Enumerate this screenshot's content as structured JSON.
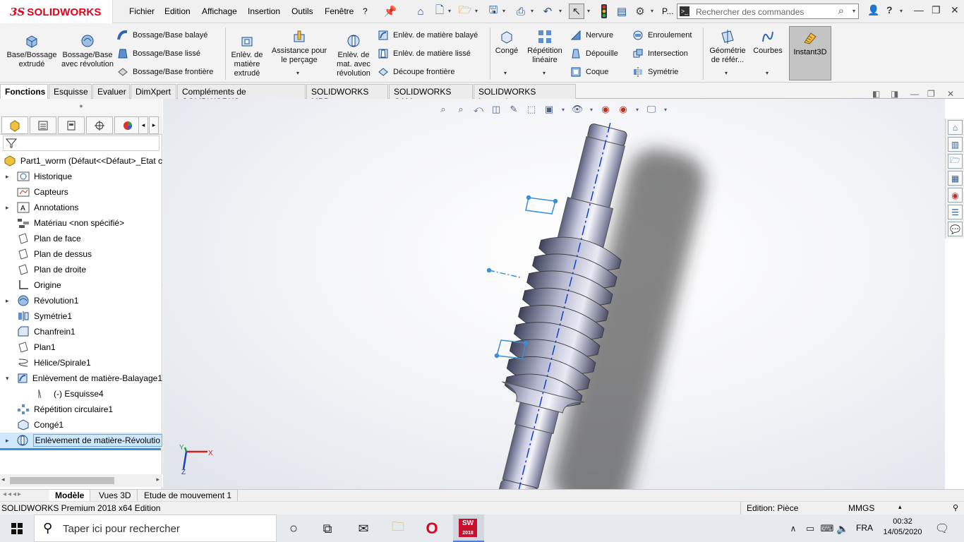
{
  "app": {
    "brand_ds": "3S",
    "brand_name": "SOLIDWORKS"
  },
  "menu": [
    "Fichier",
    "Edition",
    "Affichage",
    "Insertion",
    "Outils",
    "Fenêtre",
    "?"
  ],
  "quick_access": {
    "p_label": "P..."
  },
  "search": {
    "placeholder": "Rechercher des commandes"
  },
  "ribbon": {
    "extrude_boss": "Base/Bossage extrudé",
    "revolve_boss": "Bossage/Base avec révolution",
    "swept_boss": "Bossage/Base balayé",
    "lofted_boss": "Bossage/Base lissé",
    "boundary_boss": "Bossage/Base frontière",
    "extruded_cut": "Enlèv. de matière extrudé",
    "hole_wizard": "Assistance pour le perçage",
    "revolved_cut": "Enlèv. de mat. avec révolution",
    "swept_cut": "Enlèv. de matière balayé",
    "lofted_cut": "Enlèv. de matière lissé",
    "boundary_cut": "Découpe frontière",
    "fillet": "Congé",
    "linear_pattern": "Répétition linéaire",
    "rib": "Nervure",
    "draft": "Dépouille",
    "shell": "Coque",
    "wrap": "Enroulement",
    "intersect": "Intersection",
    "mirror": "Symétrie",
    "ref_geometry": "Géométrie de référ...",
    "curves": "Courbes",
    "instant3d": "Instant3D"
  },
  "tabs": [
    "Fonctions",
    "Esquisse",
    "Evaluer",
    "DimXpert",
    "Compléments de SOLIDWORKS",
    "SOLIDWORKS MBD",
    "SOLIDWORKS CAM",
    "SOLIDWORKS Inspection"
  ],
  "tree": {
    "root": "Part1_worm  (Défaut<<Défaut>_Etat c",
    "items": [
      {
        "label": "Historique",
        "icon": "history-icon"
      },
      {
        "label": "Capteurs",
        "icon": "sensor-icon"
      },
      {
        "label": "Annotations",
        "icon": "annotation-icon"
      },
      {
        "label": "Matériau <non spécifié>",
        "icon": "material-icon"
      },
      {
        "label": "Plan de face",
        "icon": "plane-icon"
      },
      {
        "label": "Plan de dessus",
        "icon": "plane-icon"
      },
      {
        "label": "Plan de droite",
        "icon": "plane-icon"
      },
      {
        "label": "Origine",
        "icon": "origin-icon"
      },
      {
        "label": "Révolution1",
        "icon": "revolve-icon"
      },
      {
        "label": "Symétrie1",
        "icon": "mirror-icon"
      },
      {
        "label": "Chanfrein1",
        "icon": "chamfer-icon"
      },
      {
        "label": "Plan1",
        "icon": "plane-icon"
      },
      {
        "label": "Hélice/Spirale1",
        "icon": "helix-icon"
      },
      {
        "label": "Enlèvement de matière-Balayage1",
        "icon": "swept-cut-icon"
      },
      {
        "label": "(-) Esquisse4",
        "icon": "sketch-icon"
      },
      {
        "label": "Répétition circulaire1",
        "icon": "circular-pattern-icon"
      },
      {
        "label": "Congé1",
        "icon": "fillet-icon"
      },
      {
        "label": "Enlèvement de matière-Révolutio",
        "icon": "revolved-cut-icon"
      }
    ]
  },
  "bottom_tabs": [
    "Modèle",
    "Vues 3D",
    "Etude de mouvement 1"
  ],
  "status": {
    "edition": "SOLIDWORKS Premium 2018 x64 Edition",
    "mode": "Edition: Pièce",
    "units": "MMGS"
  },
  "triad": {
    "x": "X",
    "y": "Y",
    "z": "Z"
  },
  "taskbar": {
    "search": "Taper ici pour rechercher",
    "sw_badge": "SW",
    "sw_year": "2018",
    "lang": "FRA",
    "time": "00:32",
    "date": "14/05/2020"
  },
  "colors": {
    "accent": "#e2001a",
    "select": "#cde8ff",
    "axis": "#1040c8"
  }
}
